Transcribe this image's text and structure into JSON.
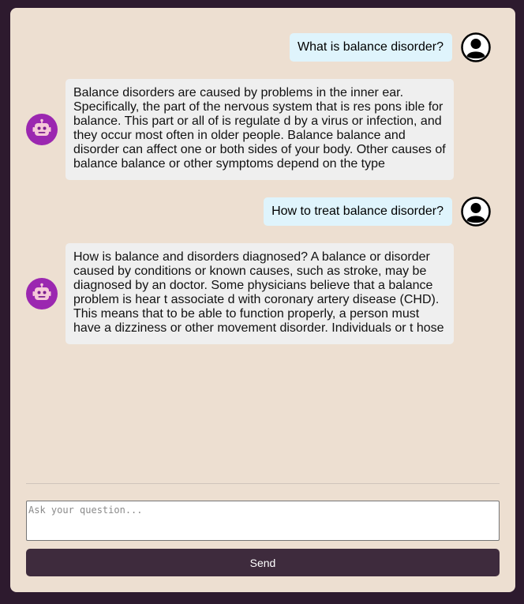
{
  "colors": {
    "page_background": "#2d1a2e",
    "card_background": "#eddfd1",
    "user_bubble": "#dff4fc",
    "bot_bubble": "#efefef",
    "bot_avatar": "#9b27b0",
    "send_button": "#3e2b3d"
  },
  "messages": [
    {
      "role": "user",
      "avatar_icon": "user-circle-icon",
      "text": "What is balance disorder?"
    },
    {
      "role": "bot",
      "avatar_icon": "robot-icon",
      "text": "Balance disorders are caused by problems in the inner ear. Specifically, the part of the nervous system that is res pons ible for balance. This part or all of is regulate d by a virus or infection, and they occur most often in older people. Balance balance and disorder can affect one or both sides of your body. Other causes of balance balance or other symptoms depend on the type"
    },
    {
      "role": "user",
      "avatar_icon": "user-circle-icon",
      "text": "How to treat balance disorder?"
    },
    {
      "role": "bot",
      "avatar_icon": "robot-icon",
      "text": "How is balance and disorders diagnosed? A balance or disorder caused by conditions or known causes, such as stroke, may be diagnosed by an doctor. Some physicians believe that a balance problem is hear t associate d with coronary artery disease (CHD). This means that to be able to function properly, a person must have a dizziness or other movement disorder. Individuals or t hose"
    }
  ],
  "input": {
    "value": "",
    "placeholder": "Ask your question..."
  },
  "send_label": "Send"
}
